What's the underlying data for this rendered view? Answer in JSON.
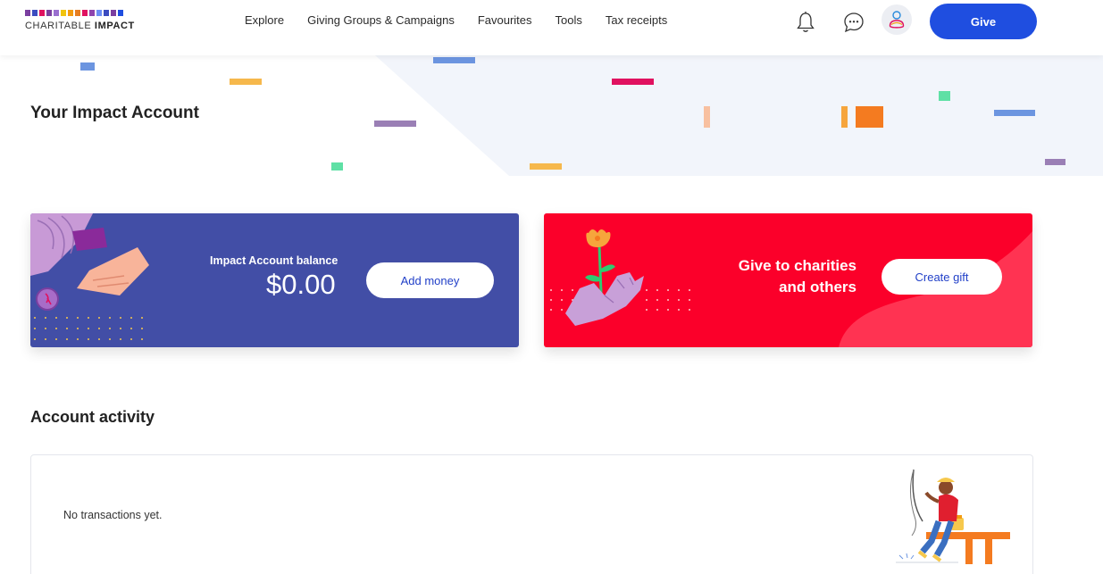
{
  "header": {
    "logo_text_prefix": "CHARITABLE ",
    "logo_text_bold": "IMPACT",
    "nav": [
      {
        "label": "Explore"
      },
      {
        "label": "Giving Groups & Campaigns"
      },
      {
        "label": "Favourites"
      },
      {
        "label": "Tools"
      },
      {
        "label": "Tax receipts"
      }
    ],
    "give_label": "Give",
    "icons": [
      "bell-icon",
      "chat-icon",
      "user-avatar-icon"
    ]
  },
  "hero": {
    "title": "Your Impact Account"
  },
  "balance_card": {
    "label": "Impact Account balance",
    "amount": "$0.00",
    "button_label": "Add money"
  },
  "give_card": {
    "line1": "Give to charities",
    "line2": "and others",
    "button_label": "Create gift"
  },
  "activity": {
    "title": "Account activity",
    "empty_message": "No transactions yet."
  },
  "colors": {
    "brand_blue": "#1f4ee0",
    "card_blue": "#424ea6",
    "card_red": "#fb002a",
    "hero_bg": "#f2f5fb"
  }
}
